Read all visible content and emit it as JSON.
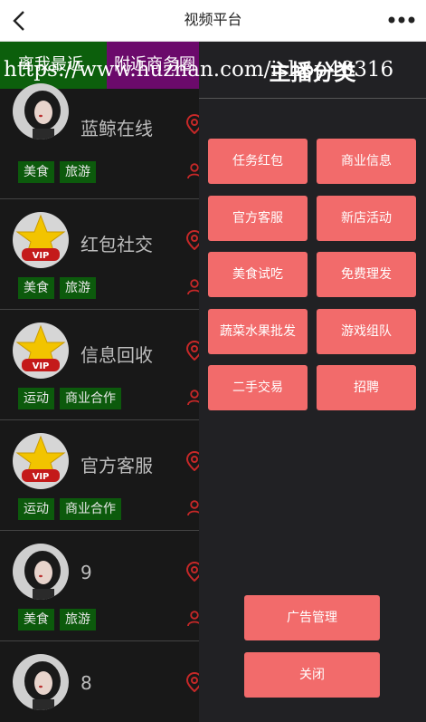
{
  "header": {
    "title": "视频平台"
  },
  "tabs": [
    {
      "label": "离我最近"
    },
    {
      "label": "附近商务圈"
    }
  ],
  "watermark": "https://www.huzhan.com/ishop40316",
  "list": [
    {
      "name": "蓝鲸在线",
      "avatar": "girl",
      "tags": [
        "美食",
        "旅游"
      ]
    },
    {
      "name": "红包社交",
      "avatar": "vip",
      "tags": [
        "美食",
        "旅游"
      ]
    },
    {
      "name": "信息回收",
      "avatar": "vip",
      "tags": [
        "运动",
        "商业合作"
      ]
    },
    {
      "name": "官方客服",
      "avatar": "vip",
      "tags": [
        "运动",
        "商业合作"
      ]
    },
    {
      "name": "9",
      "avatar": "girl",
      "tags": [
        "美食",
        "旅游"
      ]
    },
    {
      "name": "8",
      "avatar": "girl",
      "tags": []
    }
  ],
  "panel": {
    "title": "主播分类",
    "categories": [
      "任务红包",
      "商业信息",
      "官方客服",
      "新店活动",
      "美食试吃",
      "免费理发",
      "蔬菜水果批发",
      "游戏组队",
      "二手交易",
      "招聘"
    ],
    "ad_manage_label": "广告管理",
    "close_label": "关闭"
  },
  "colors": {
    "accent": "#f26b6b",
    "tab_green": "#0c5f0c",
    "tab_purple": "#6b0a6b",
    "tag_green": "#0c5a0c",
    "panel_bg": "#212124"
  }
}
